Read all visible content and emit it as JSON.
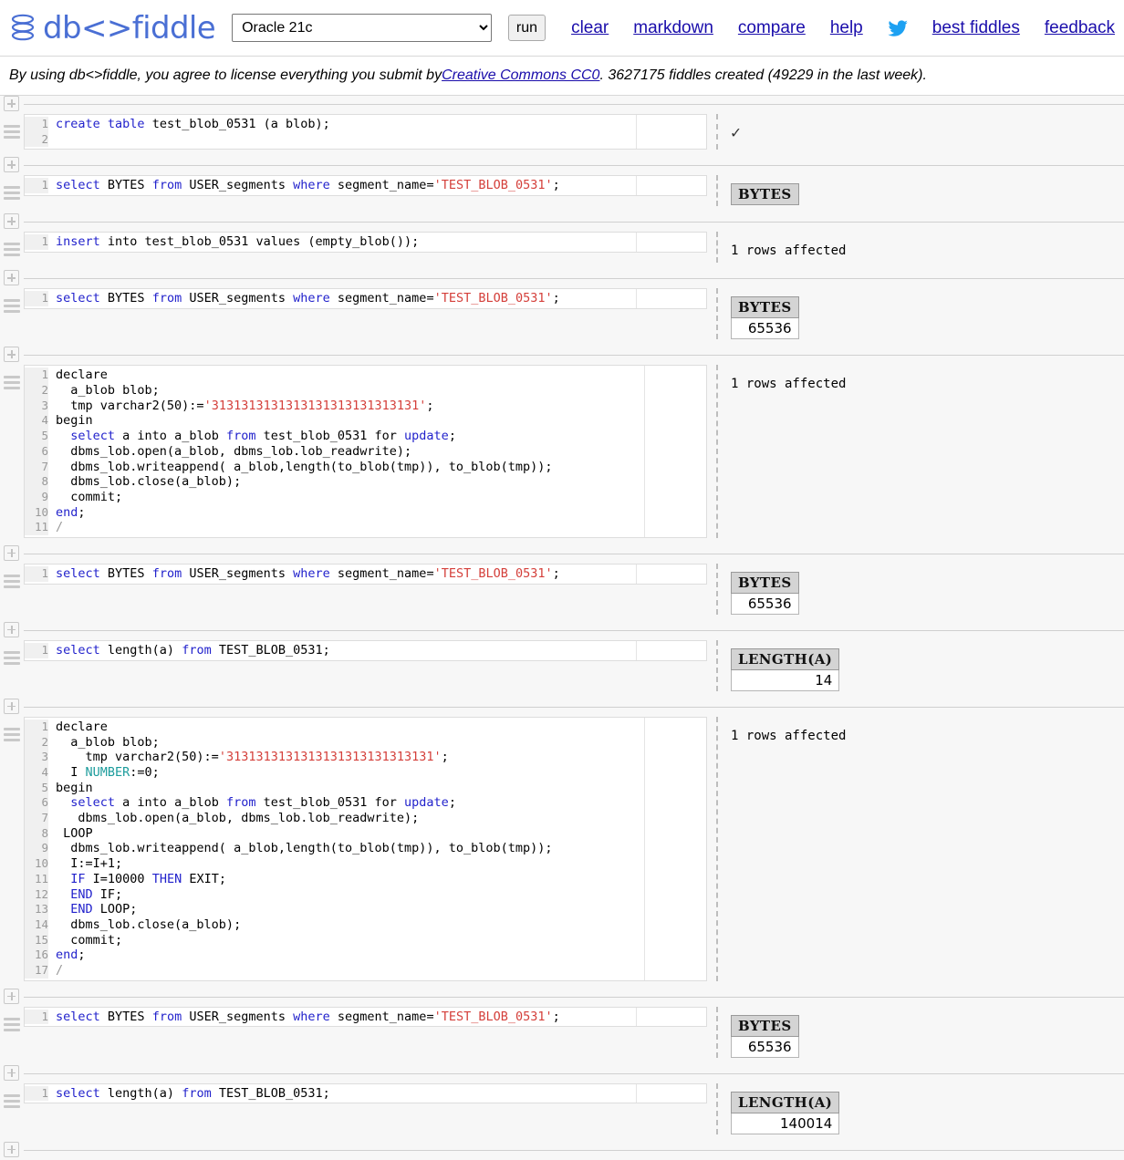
{
  "header": {
    "logo_text": "db<>fiddle",
    "logo_icon": "database-stack-icon",
    "db_selected": "Oracle 21c",
    "db_options": [
      "Oracle 21c"
    ],
    "run_label": "run",
    "links": [
      {
        "label": "clear",
        "name": "clear"
      },
      {
        "label": "markdown",
        "name": "markdown"
      },
      {
        "label": "compare",
        "name": "compare"
      },
      {
        "label": "help",
        "name": "help"
      }
    ],
    "twitter_icon": "twitter-bird-icon",
    "links_right": [
      {
        "label": "best fiddles",
        "name": "best-fiddles"
      },
      {
        "label": "feedback",
        "name": "feedback"
      }
    ]
  },
  "notice": {
    "text_before": "By using db<>fiddle, you agree to license everything you submit by ",
    "link": "Creative Commons CC0",
    "text_after": ". 3627175 fiddles created (49229 in the last week)."
  },
  "blocks": [
    {
      "id": 1,
      "lines": [
        [
          {
            "t": "create ",
            "c": "kw"
          },
          {
            "t": "table ",
            "c": "kw"
          },
          {
            "t": "test_blob_0531 (a blob);",
            "c": ""
          }
        ],
        []
      ],
      "result_type": "check",
      "result_text": "✓"
    },
    {
      "id": 2,
      "lines": [
        [
          {
            "t": "select ",
            "c": "kw"
          },
          {
            "t": "BYTES ",
            "c": ""
          },
          {
            "t": "from ",
            "c": "kw"
          },
          {
            "t": "USER_segments ",
            "c": ""
          },
          {
            "t": "where ",
            "c": "kw"
          },
          {
            "t": "segment_name=",
            "c": ""
          },
          {
            "t": "'TEST_BLOB_0531'",
            "c": "str"
          },
          {
            "t": ";",
            "c": ""
          }
        ]
      ],
      "result_type": "table_header_only",
      "columns": [
        "BYTES"
      ],
      "rows": []
    },
    {
      "id": 3,
      "lines": [
        [
          {
            "t": "insert ",
            "c": "kw"
          },
          {
            "t": "into test_blob_0531 values (empty_blob());",
            "c": ""
          }
        ]
      ],
      "result_type": "affected",
      "result_text": "1 rows affected"
    },
    {
      "id": 4,
      "lines": [
        [
          {
            "t": "select ",
            "c": "kw"
          },
          {
            "t": "BYTES ",
            "c": ""
          },
          {
            "t": "from ",
            "c": "kw"
          },
          {
            "t": "USER_segments ",
            "c": ""
          },
          {
            "t": "where ",
            "c": "kw"
          },
          {
            "t": "segment_name=",
            "c": ""
          },
          {
            "t": "'TEST_BLOB_0531'",
            "c": "str"
          },
          {
            "t": ";",
            "c": ""
          }
        ]
      ],
      "result_type": "table",
      "columns": [
        "BYTES"
      ],
      "rows": [
        [
          "65536"
        ]
      ]
    },
    {
      "id": 5,
      "lines": [
        [
          {
            "t": "declare",
            "c": ""
          }
        ],
        [
          {
            "t": "  a_blob blob;",
            "c": ""
          }
        ],
        [
          {
            "t": "  tmp varchar2(50):=",
            "c": ""
          },
          {
            "t": "'3131313131313131313131313131'",
            "c": "str"
          },
          {
            "t": ";",
            "c": ""
          }
        ],
        [
          {
            "t": "begin",
            "c": ""
          }
        ],
        [
          {
            "t": "  ",
            "c": ""
          },
          {
            "t": "select ",
            "c": "kw"
          },
          {
            "t": "a into a_blob ",
            "c": ""
          },
          {
            "t": "from ",
            "c": "kw"
          },
          {
            "t": "test_blob_0531 for ",
            "c": ""
          },
          {
            "t": "update",
            "c": "kw"
          },
          {
            "t": ";",
            "c": ""
          }
        ],
        [
          {
            "t": "  dbms_lob.open(a_blob, dbms_lob.lob_readwrite);",
            "c": ""
          }
        ],
        [
          {
            "t": "  dbms_lob.writeappend( a_blob,length(to_blob(tmp)), to_blob(tmp));",
            "c": ""
          }
        ],
        [
          {
            "t": "  dbms_lob.close(a_blob);",
            "c": ""
          }
        ],
        [
          {
            "t": "  commit;",
            "c": ""
          }
        ],
        [
          {
            "t": "end",
            "c": "kw"
          },
          {
            "t": ";",
            "c": ""
          }
        ],
        [
          {
            "t": "/",
            "c": "cm"
          }
        ]
      ],
      "result_type": "affected",
      "result_text": "1 rows affected"
    },
    {
      "id": 6,
      "lines": [
        [
          {
            "t": "select ",
            "c": "kw"
          },
          {
            "t": "BYTES ",
            "c": ""
          },
          {
            "t": "from ",
            "c": "kw"
          },
          {
            "t": "USER_segments ",
            "c": ""
          },
          {
            "t": "where ",
            "c": "kw"
          },
          {
            "t": "segment_name=",
            "c": ""
          },
          {
            "t": "'TEST_BLOB_0531'",
            "c": "str"
          },
          {
            "t": ";",
            "c": ""
          }
        ]
      ],
      "result_type": "table",
      "columns": [
        "BYTES"
      ],
      "rows": [
        [
          "65536"
        ]
      ]
    },
    {
      "id": 7,
      "lines": [
        [
          {
            "t": "select ",
            "c": "kw"
          },
          {
            "t": "length(a) ",
            "c": ""
          },
          {
            "t": "from ",
            "c": "kw"
          },
          {
            "t": "TEST_BLOB_0531;",
            "c": ""
          }
        ]
      ],
      "result_type": "table",
      "columns": [
        "LENGTH(A)"
      ],
      "rows": [
        [
          "14"
        ]
      ]
    },
    {
      "id": 8,
      "lines": [
        [
          {
            "t": "declare",
            "c": ""
          }
        ],
        [
          {
            "t": "  a_blob blob;",
            "c": ""
          }
        ],
        [
          {
            "t": "    tmp varchar2(50):=",
            "c": ""
          },
          {
            "t": "'3131313131313131313131313131'",
            "c": "str"
          },
          {
            "t": ";",
            "c": ""
          }
        ],
        [
          {
            "t": "  I ",
            "c": ""
          },
          {
            "t": "NUMBER",
            "c": "num"
          },
          {
            "t": ":=0;",
            "c": ""
          }
        ],
        [
          {
            "t": "begin",
            "c": ""
          }
        ],
        [
          {
            "t": "  ",
            "c": ""
          },
          {
            "t": "select ",
            "c": "kw"
          },
          {
            "t": "a into a_blob ",
            "c": ""
          },
          {
            "t": "from ",
            "c": "kw"
          },
          {
            "t": "test_blob_0531 for ",
            "c": ""
          },
          {
            "t": "update",
            "c": "kw"
          },
          {
            "t": ";",
            "c": ""
          }
        ],
        [
          {
            "t": "   dbms_lob.open(a_blob, dbms_lob.lob_readwrite);",
            "c": ""
          }
        ],
        [
          {
            "t": " LOOP",
            "c": ""
          }
        ],
        [
          {
            "t": "  dbms_lob.writeappend( a_blob,length(to_blob(tmp)), to_blob(tmp));",
            "c": ""
          }
        ],
        [
          {
            "t": "  I:=I+1;",
            "c": ""
          }
        ],
        [
          {
            "t": "  ",
            "c": ""
          },
          {
            "t": "IF ",
            "c": "kw"
          },
          {
            "t": "I=10000 ",
            "c": ""
          },
          {
            "t": "THEN ",
            "c": "kw"
          },
          {
            "t": "EXIT;",
            "c": ""
          }
        ],
        [
          {
            "t": "  ",
            "c": ""
          },
          {
            "t": "END ",
            "c": "kw"
          },
          {
            "t": "IF;",
            "c": ""
          }
        ],
        [
          {
            "t": "  ",
            "c": ""
          },
          {
            "t": "END ",
            "c": "kw"
          },
          {
            "t": "LOOP;",
            "c": ""
          }
        ],
        [
          {
            "t": "  dbms_lob.close(a_blob);",
            "c": ""
          }
        ],
        [
          {
            "t": "  commit;",
            "c": ""
          }
        ],
        [
          {
            "t": "end",
            "c": "kw"
          },
          {
            "t": ";",
            "c": ""
          }
        ],
        [
          {
            "t": "/",
            "c": "cm"
          }
        ]
      ],
      "result_type": "affected",
      "result_text": "1 rows affected"
    },
    {
      "id": 9,
      "lines": [
        [
          {
            "t": "select ",
            "c": "kw"
          },
          {
            "t": "BYTES ",
            "c": ""
          },
          {
            "t": "from ",
            "c": "kw"
          },
          {
            "t": "USER_segments ",
            "c": ""
          },
          {
            "t": "where ",
            "c": "kw"
          },
          {
            "t": "segment_name=",
            "c": ""
          },
          {
            "t": "'TEST_BLOB_0531'",
            "c": "str"
          },
          {
            "t": ";",
            "c": ""
          }
        ]
      ],
      "result_type": "table",
      "columns": [
        "BYTES"
      ],
      "rows": [
        [
          "65536"
        ]
      ]
    },
    {
      "id": 10,
      "lines": [
        [
          {
            "t": "select ",
            "c": "kw"
          },
          {
            "t": "length(a) ",
            "c": ""
          },
          {
            "t": "from ",
            "c": "kw"
          },
          {
            "t": "TEST_BLOB_0531;",
            "c": ""
          }
        ]
      ],
      "result_type": "table",
      "columns": [
        "LENGTH(A)"
      ],
      "rows": [
        [
          "140014"
        ]
      ]
    }
  ],
  "colors": {
    "logo_blue": "#4a6fd4",
    "link_blue": "#1a0dab",
    "keyword": "#2222cc",
    "string": "#d43f3a",
    "type": "#1c9c9c",
    "page_bg": "#f7f7f7"
  }
}
